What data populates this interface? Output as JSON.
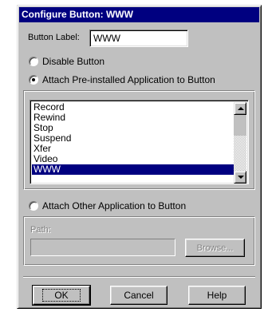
{
  "dialog": {
    "title": "Configure Button:  WWW"
  },
  "button_label": {
    "label": "Button Label:",
    "value": "WWW"
  },
  "options": {
    "disable": {
      "label": "Disable Button",
      "selected": false
    },
    "preinstalled": {
      "label": "Attach Pre-installed Application to Button",
      "selected": true
    },
    "other": {
      "label": "Attach Other Application to Button",
      "selected": false
    }
  },
  "app_list": {
    "items": [
      "Record",
      "Rewind",
      "Stop",
      "Suspend",
      "Xfer",
      "Video",
      "WWW"
    ],
    "selected": "WWW"
  },
  "path": {
    "label": "Path:",
    "value": "",
    "browse_label": "Browse..."
  },
  "buttons": {
    "ok": "OK",
    "cancel": "Cancel",
    "help": "Help"
  },
  "icons": {
    "scroll_up": "triangle-up",
    "scroll_down": "triangle-down"
  }
}
